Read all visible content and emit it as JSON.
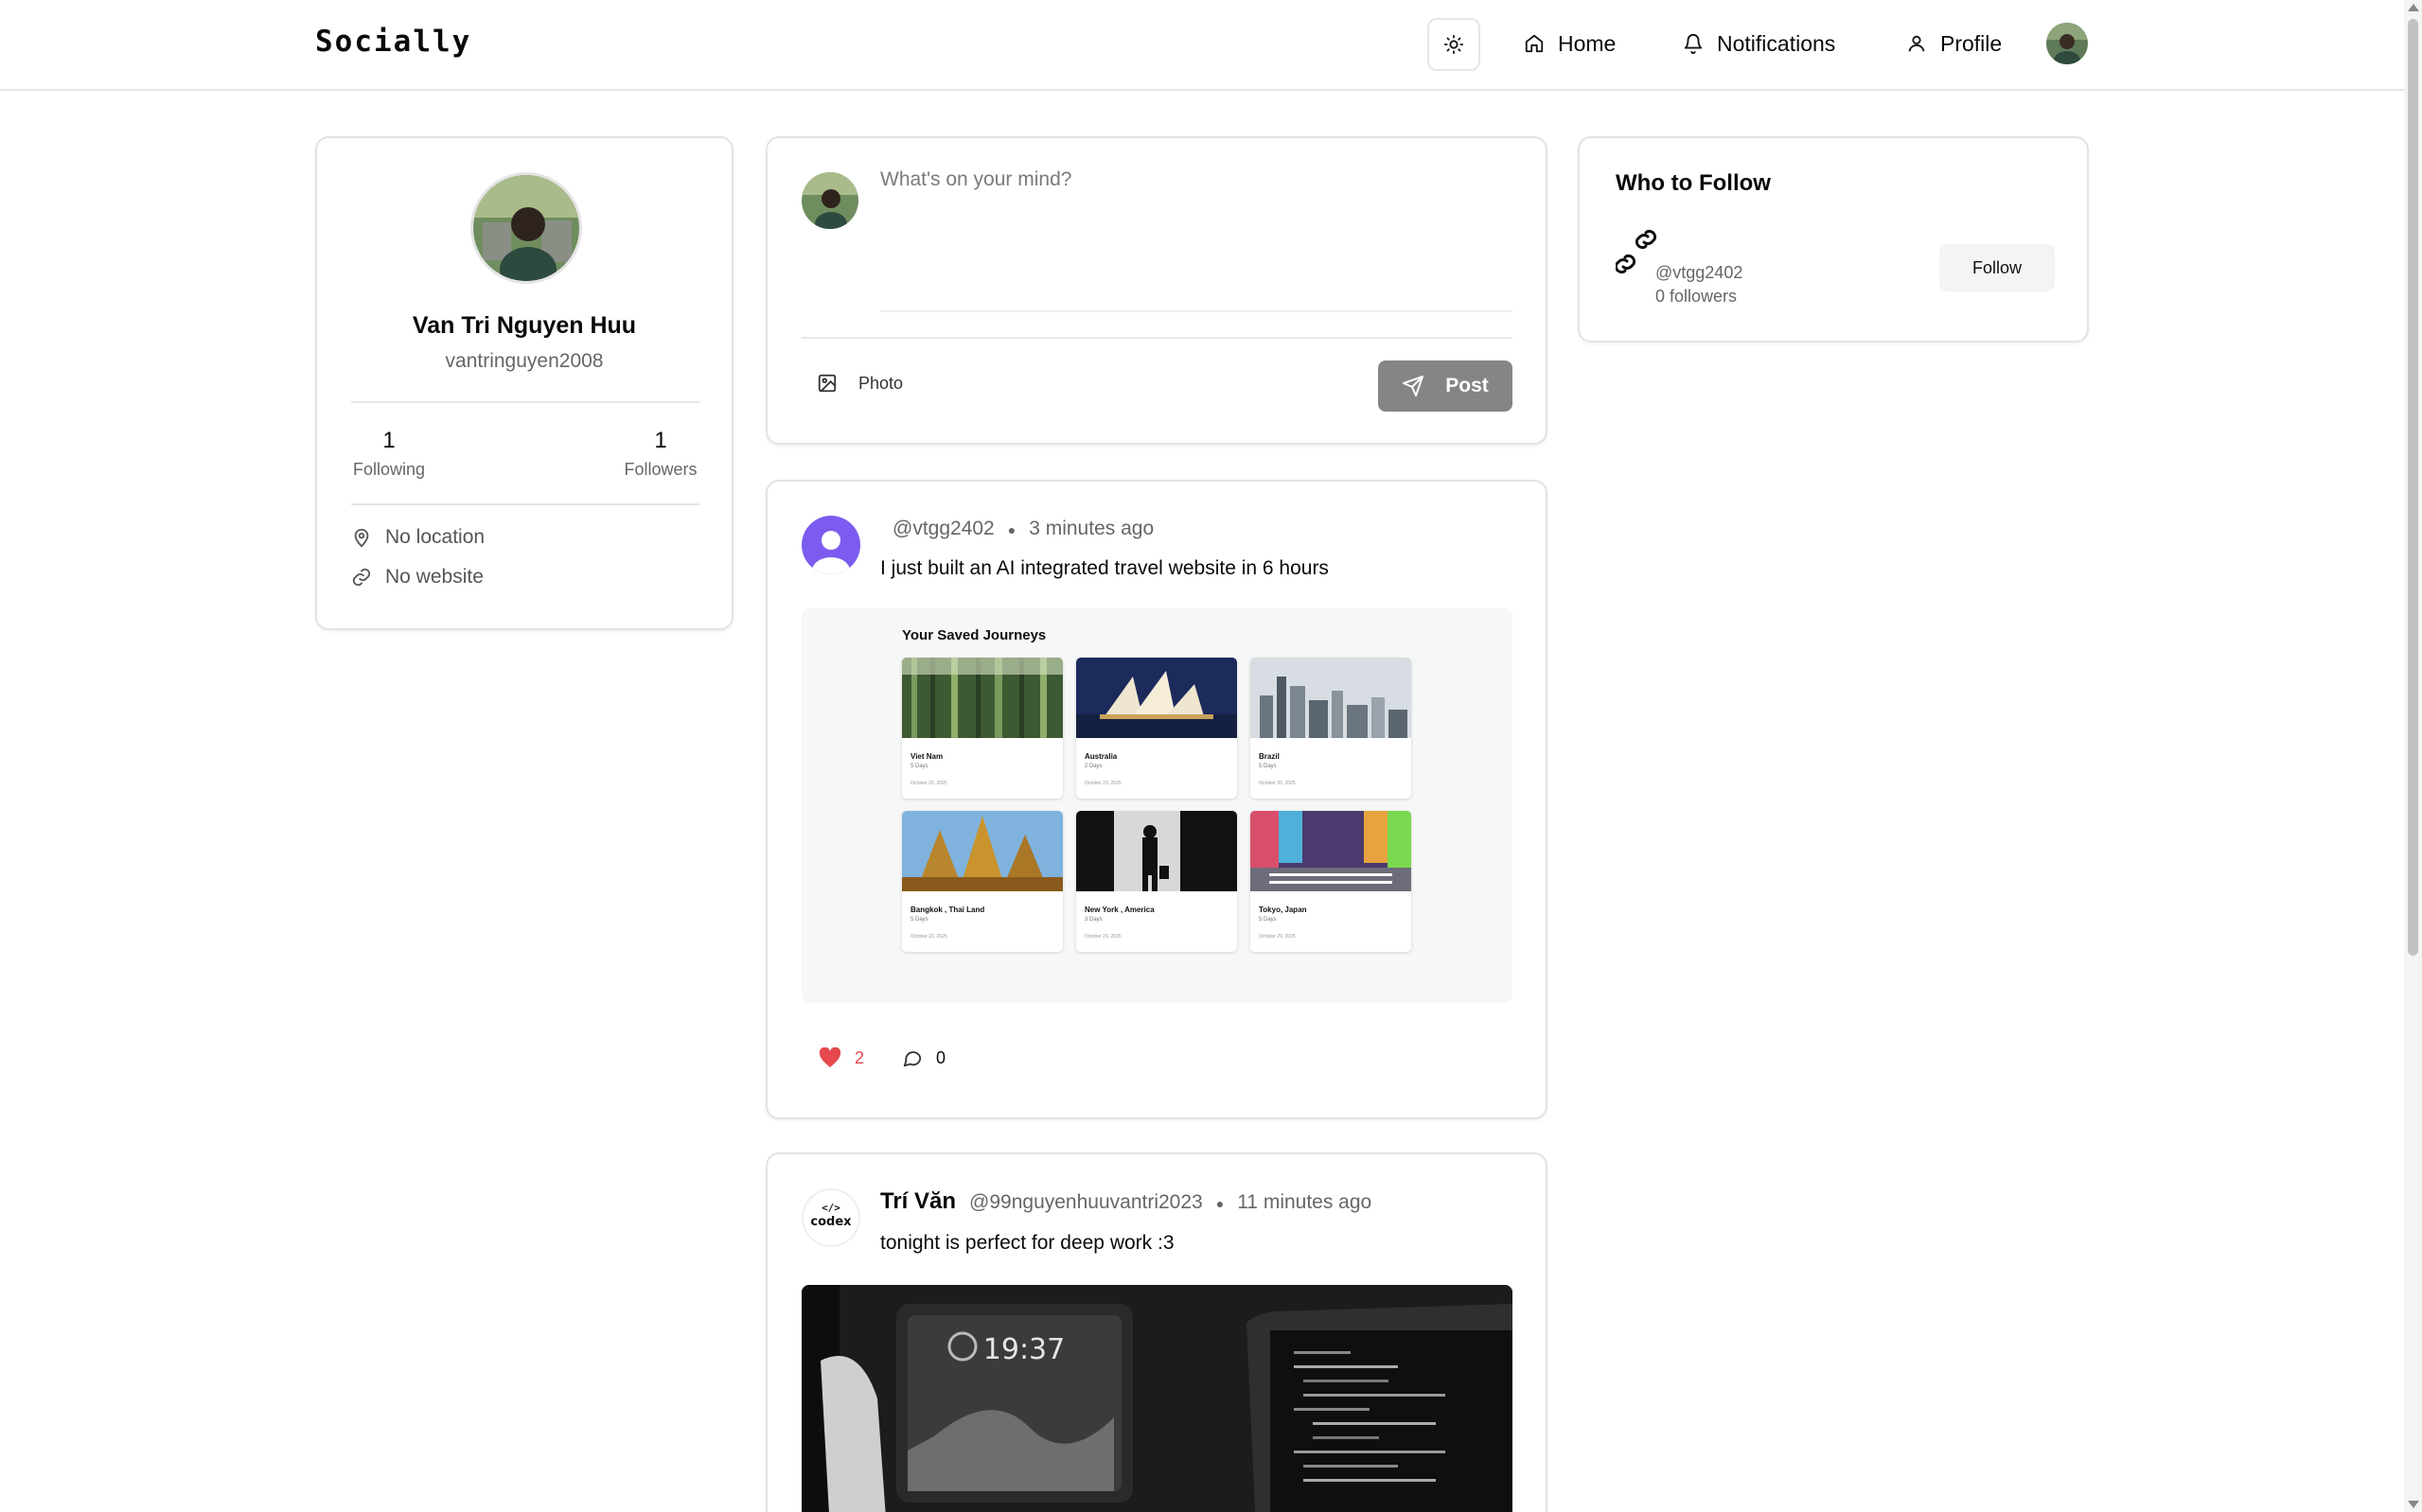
{
  "app": {
    "brand": "Socially"
  },
  "nav": {
    "home": "Home",
    "notifications": "Notifications",
    "profile": "Profile"
  },
  "profile": {
    "name": "Van Tri Nguyen Huu",
    "handle": "vantringuyen2008",
    "following_count": "1",
    "following_label": "Following",
    "followers_count": "1",
    "followers_label": "Followers",
    "location": "No location",
    "website": "No website"
  },
  "composer": {
    "placeholder": "What's on your mind?",
    "photo_label": "Photo",
    "post_label": "Post"
  },
  "posts": [
    {
      "author": "",
      "handle": "@vtgg2402",
      "time": "3 minutes ago",
      "text": "I just built an AI integrated travel website in 6 hours",
      "likes": "2",
      "comments": "0",
      "image": {
        "title": "Your Saved Journeys",
        "cards": [
          {
            "name": "Viet Nam",
            "days": "5 Days",
            "date": "October 25, 2025"
          },
          {
            "name": "Australia",
            "days": "2 Days",
            "date": "October 23, 2025"
          },
          {
            "name": "Brazil",
            "days": "5 Days",
            "date": "October 30, 2025"
          },
          {
            "name": "Bangkok , Thai Land",
            "days": "5 Days",
            "date": "October 23, 2025"
          },
          {
            "name": "New York , America",
            "days": "3 Days",
            "date": "October 29, 2025"
          },
          {
            "name": "Tokyo, Japan",
            "days": "5 Days",
            "date": "October 29, 2025"
          }
        ]
      }
    },
    {
      "author": "Trí Văn",
      "handle": "@99nguyenhuuvantri2023",
      "time": "11 minutes ago",
      "text": "tonight is perfect for deep work :3",
      "image": {
        "clock": "19:37"
      },
      "avatar_text": "codex"
    }
  ],
  "who_to_follow": {
    "title": "Who to Follow",
    "users": [
      {
        "handle": "@vtgg2402",
        "followers": "0 followers",
        "button": "Follow"
      }
    ]
  },
  "colors": {
    "like": "#e5484d",
    "post_button": "#858585",
    "avatar_purple": "#7c5cf0"
  }
}
